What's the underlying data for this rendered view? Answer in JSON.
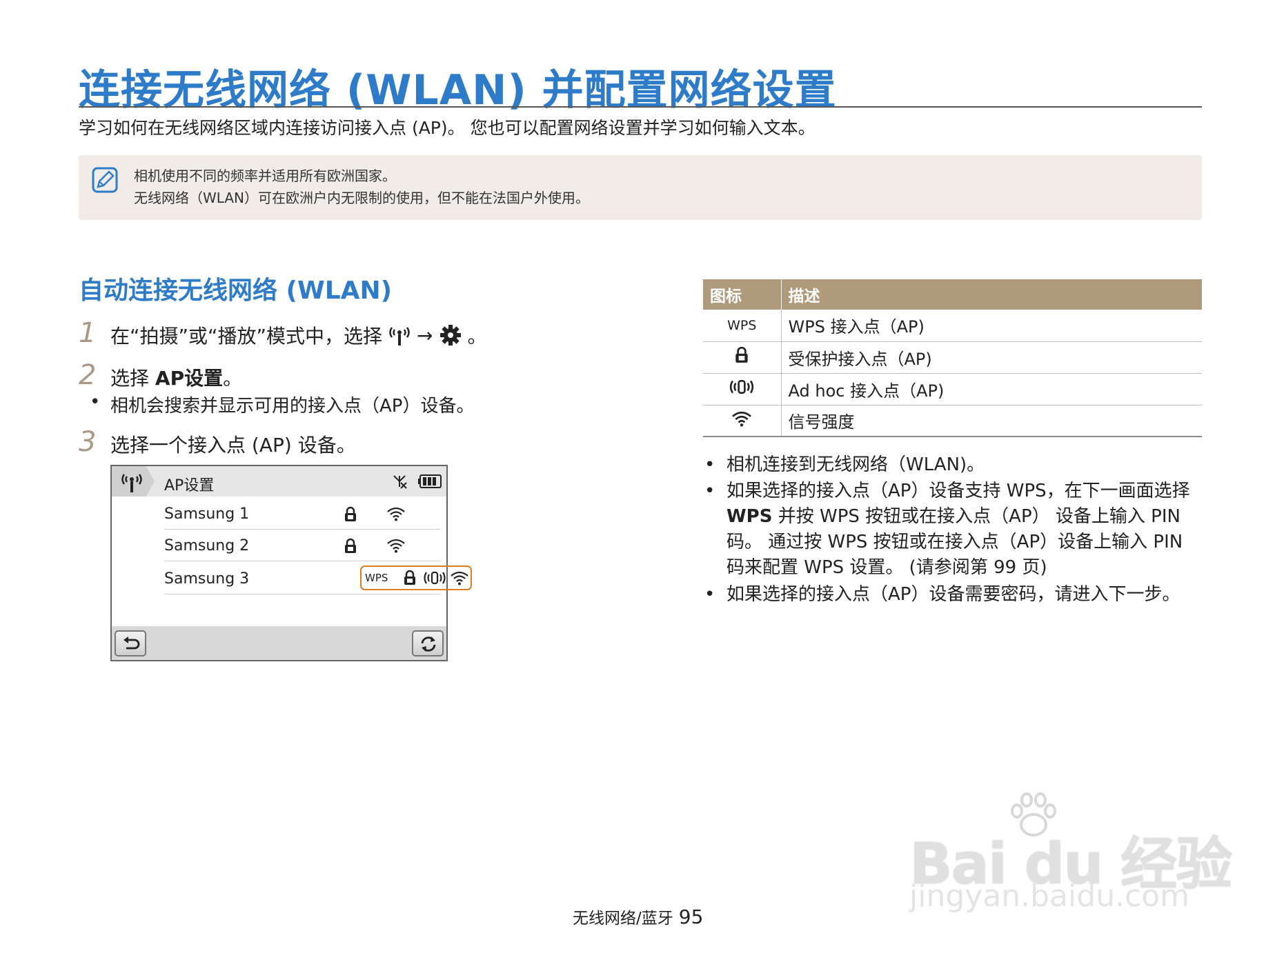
{
  "page": {
    "title": "连接无线网络 (WLAN) 并配置网络设置",
    "subtitle": "学习如何在无线网络区域内连接访问接入点 (AP)。 您也可以配置网络设置并学习如何输入文本。"
  },
  "note": {
    "icon": "note-pencil-icon",
    "line1": "相机使用不同的频率并适用所有欧洲国家。",
    "line2": "无线网络（WLAN）可在欧洲户内无限制的使用，但不能在法国户外使用。"
  },
  "section": {
    "title": "自动连接无线网络 (WLAN)",
    "steps": [
      {
        "num": "1",
        "before": "在“拍摄”或“播放”模式中，选择",
        "arrow": "→",
        "after": "。"
      },
      {
        "num": "2",
        "before": "选择 ",
        "bold": "AP设置",
        "after": "。"
      },
      {
        "num": "3",
        "text": "选择一个接入点 (AP) 设备。"
      }
    ],
    "step2_bullet": "相机会搜索并显示可用的接入点（AP）设备。"
  },
  "screen": {
    "title": "AP设置",
    "rows": [
      {
        "name": "Samsung 1"
      },
      {
        "name": "Samsung 2"
      },
      {
        "name": "Samsung 3",
        "wps": "WPS"
      }
    ]
  },
  "table": {
    "headers": [
      "图标",
      "描述"
    ],
    "rows": [
      {
        "icon_text": "WPS",
        "desc": "WPS 接入点（AP)"
      },
      {
        "icon": "lock-icon",
        "desc": "受保护接入点（AP)"
      },
      {
        "icon": "adhoc-icon",
        "desc": "Ad hoc 接入点（AP)"
      },
      {
        "icon": "wifi-signal-icon",
        "desc": "信号强度"
      }
    ]
  },
  "bullets": {
    "b1": "相机连接到无线网络（WLAN)。",
    "b2_1": "如果选择的接入点（AP）设备支持 WPS，在下一画面选择",
    "b2_bold": "WPS",
    "b2_2": " 并按 WPS 按钮或在接入点（AP） 设备上输入 PIN",
    "b2_3": "码。 通过按 WPS 按钮或在接入点（AP）设备上输入 PIN",
    "b2_4": "码来配置 WPS 设置。 (请参阅第 99 页)",
    "b3": "如果选择的接入点（AP）设备需要密码，请进入下一步。"
  },
  "footer": {
    "section": "无线网络/蓝牙",
    "page": "95"
  },
  "watermark": {
    "logo": "Bai du 经验",
    "url": "jingyan.baidu.com"
  }
}
